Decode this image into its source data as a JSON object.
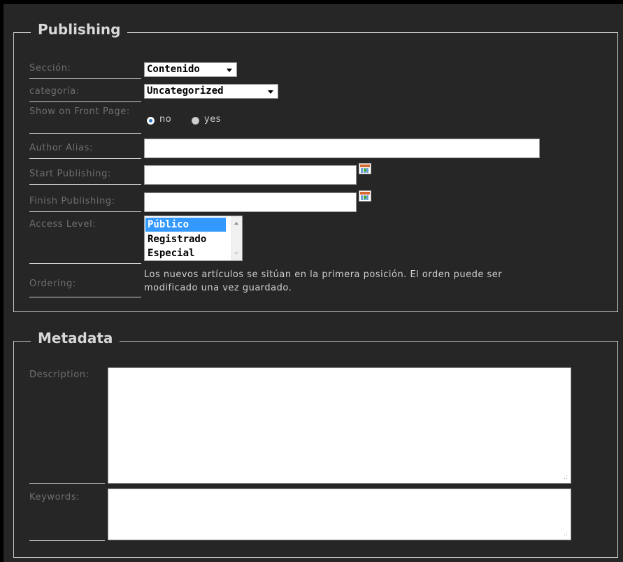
{
  "publishing": {
    "legend": "Publishing",
    "section": {
      "label": "Sección:",
      "value": "Contenido"
    },
    "category": {
      "label": "categoría:",
      "value": "Uncategorized"
    },
    "front_page": {
      "label": "Show on Front Page:",
      "options": [
        {
          "label": "no",
          "checked": true
        },
        {
          "label": "yes",
          "checked": false
        }
      ]
    },
    "author_alias": {
      "label": "Author Alias:",
      "value": ""
    },
    "start_publishing": {
      "label": "Start Publishing:",
      "value": "",
      "icon": "calendar-icon"
    },
    "finish_publishing": {
      "label": "Finish Publishing:",
      "value": "",
      "icon": "calendar-icon"
    },
    "access_level": {
      "label": "Access Level:",
      "options": [
        "Público",
        "Registrado",
        "Especial"
      ],
      "selected": "Público"
    },
    "ordering": {
      "label": "Ordering:",
      "text_line1": "Los nuevos artículos se sitúan en la primera posición. El orden puede ser",
      "text_line2": "modificado una vez guardado."
    }
  },
  "metadata": {
    "legend": "Metadata",
    "description": {
      "label": "Description:",
      "value": ""
    },
    "keywords": {
      "label": "Keywords:",
      "value": ""
    }
  },
  "colors": {
    "background": "#262626",
    "label": "#6f6f6f",
    "border": "#c9c9c9",
    "selection": "#3399ff"
  }
}
